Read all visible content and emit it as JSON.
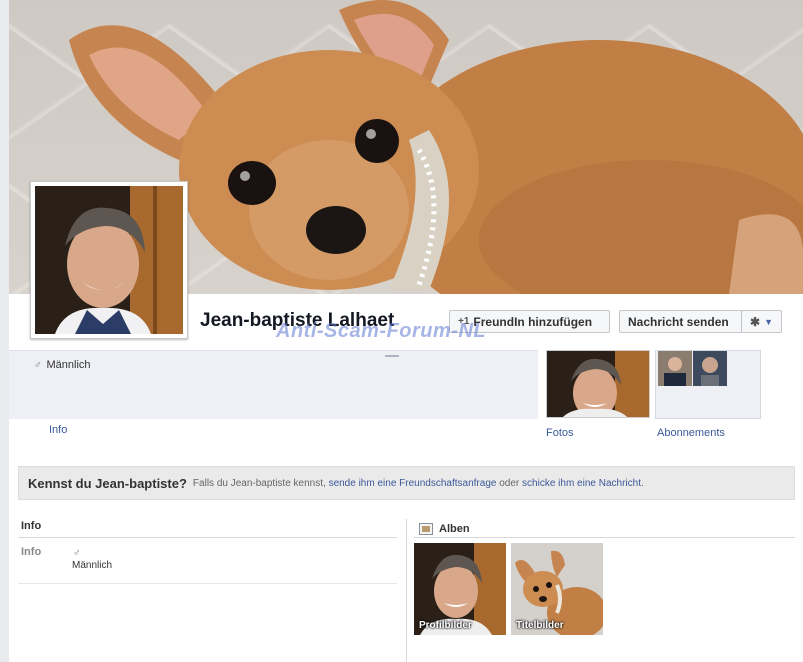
{
  "profile": {
    "name": "Jean-baptiste Lalhaet",
    "gender_symbol": "♂",
    "gender": "Männlich"
  },
  "actions": {
    "add_friend_label": "FreundIn hinzufügen",
    "add_friend_icon": "+1",
    "message_label": "Nachricht senden",
    "gear_icon": "✱",
    "chevron_icon": "▼"
  },
  "watermark": "Anti-Scam-Forum-NL",
  "nav": {
    "info_label": "Info",
    "photos_label": "Fotos",
    "subscriptions_label": "Abonnements"
  },
  "know_bar": {
    "title": "Kennst du Jean-baptiste?",
    "text_before": "Falls du Jean-baptiste kennst,",
    "link_request": "sende ihm eine Freundschaftsanfrage",
    "text_middle": "oder",
    "link_message": "schicke ihm eine Nachricht",
    "text_end": "."
  },
  "info_section": {
    "heading": "Info",
    "row_key": "Info",
    "row_symbol": "♂",
    "row_value": "Männlich"
  },
  "albums_section": {
    "heading": "Alben",
    "albums": [
      {
        "caption": "Profilbilder"
      },
      {
        "caption": "Titelbilder"
      }
    ]
  },
  "colors": {
    "link": "#3b5998",
    "panel": "#eef0f5",
    "dog_fur": "#c98a4e"
  }
}
